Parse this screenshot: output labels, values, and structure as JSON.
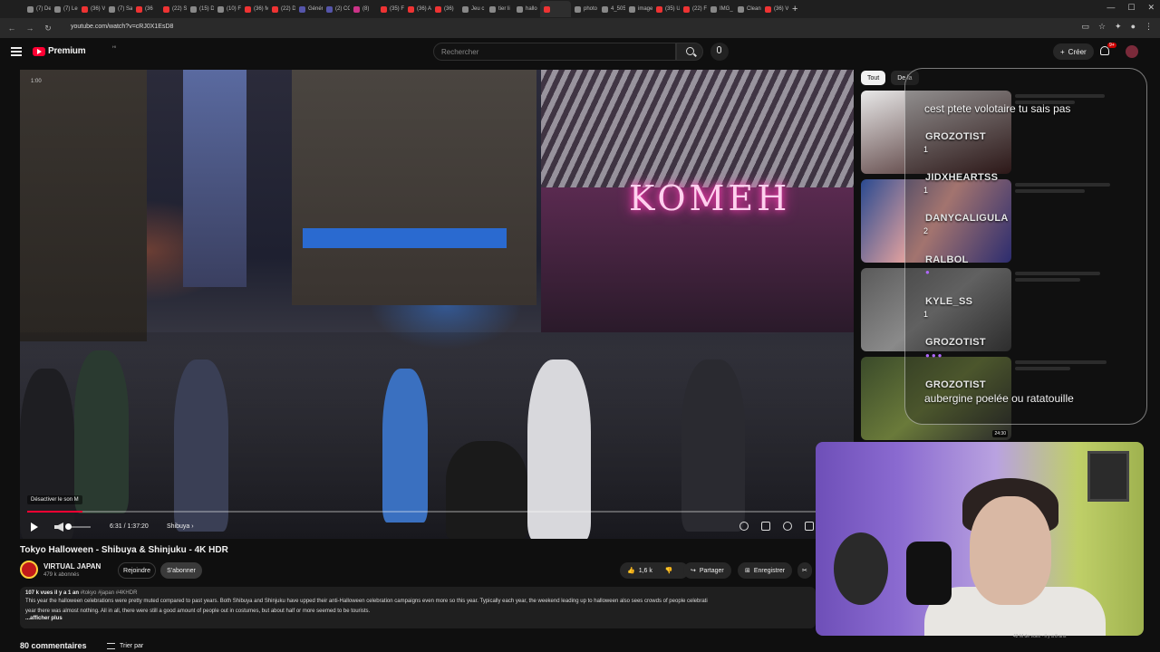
{
  "browser": {
    "tabs": [
      "(7) De",
      "(7) Le",
      "(36) V",
      "(7) Sal",
      "(36",
      "(22) S",
      "(15) D",
      "(10) F",
      "(36) M",
      "(22) Di",
      "Généré",
      "(2) CO",
      "(8)",
      "(35) F",
      "(36) A",
      "(36)",
      "Jeu c",
      "tier li",
      "hallo",
      "",
      "photo",
      "4_505",
      "image",
      "(35) U",
      "(22) Fr",
      "IMG_",
      "Clean",
      "(36) V"
    ],
    "url": "youtube.com/watch?v=cRJ0X1EsD8"
  },
  "header": {
    "logo_text": "Premium",
    "logo_sup": "HI",
    "search_placeholder": "Rechercher",
    "create_label": "Créer",
    "notif_badge": "9+"
  },
  "video": {
    "top_time": "1:00",
    "sign_text": "KOMEH",
    "mute_tooltip": "Désactiver le son  M",
    "time": "6:31 / 1:37:20",
    "chapter": "Shibuya  ›",
    "progress": 0.067
  },
  "meta": {
    "title": "Tokyo Halloween - Shibuya & Shinjuku - 4K HDR",
    "channel": "VIRTUAL JAPAN",
    "subs": "479 k abonnés",
    "join": "Rejoindre",
    "subscribed": "S'abonner",
    "likes": "1,6 k",
    "share": "Partager",
    "save": "Enregistrer",
    "desc_stats": "107 k vues  il y a 1 an",
    "desc_tags": "#tokyo #japan #4KHDR",
    "desc_line1": "This year the halloween celebrations were pretty muted compared to past years. Both Shibuya and Shinjuku have upped their anti-Halloween celebration campaigns even more so this year. Typically each year, the weekend leading up to halloween also sees crowds of people celebrati",
    "desc_line2": "year there was almost nothing. All in all, there were still a good amount of people out in costumes, but about half or more seemed to be tourists.",
    "desc_more": "...afficher plus",
    "comments": "80 commentaires",
    "sort": "Trier par"
  },
  "sidebar": {
    "chips": [
      "Tout",
      "De la"
    ],
    "duration": "24:30",
    "caption": "42 M de vues · il y a 8 ans"
  },
  "chat": {
    "top_message": "cest ptete volotaire tu sais pas",
    "entries": [
      {
        "user": "GROZOTIST",
        "count": "1"
      },
      {
        "user": "JIDXHEARTSS",
        "count": "1"
      },
      {
        "user": "DANYCALIGULA",
        "count": "2"
      },
      {
        "user": "RALBOL",
        "count": ""
      },
      {
        "user": "KYLE_SS",
        "count": "1"
      },
      {
        "user": "GROZOTIST",
        "count": ""
      },
      {
        "user": "GROZOTIST",
        "count": ""
      }
    ],
    "bottom_message": "aubergine poelée ou ratatouille"
  },
  "colors": {
    "accent": "#ff0033",
    "chat_border": "#ffffff"
  }
}
